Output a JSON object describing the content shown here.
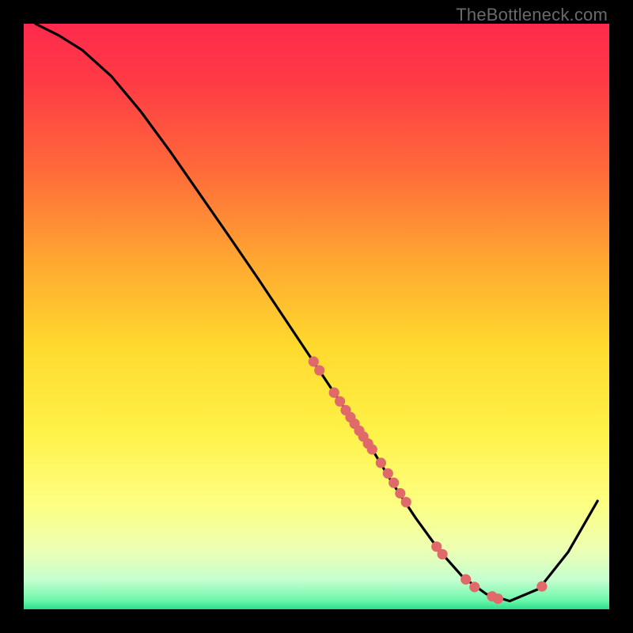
{
  "watermark": "TheBottleneck.com",
  "chart_data": {
    "type": "line",
    "title": "",
    "xlabel": "",
    "ylabel": "",
    "xlim": [
      0,
      100
    ],
    "ylim": [
      0,
      100
    ],
    "gradient_stops": [
      {
        "offset": 0.0,
        "color": "#ff2a4d"
      },
      {
        "offset": 0.1,
        "color": "#ff3b45"
      },
      {
        "offset": 0.25,
        "color": "#ff6a3a"
      },
      {
        "offset": 0.4,
        "color": "#ffa531"
      },
      {
        "offset": 0.55,
        "color": "#ffd92e"
      },
      {
        "offset": 0.7,
        "color": "#fff248"
      },
      {
        "offset": 0.82,
        "color": "#fdff82"
      },
      {
        "offset": 0.9,
        "color": "#ecffb4"
      },
      {
        "offset": 0.95,
        "color": "#c5ffcf"
      },
      {
        "offset": 0.985,
        "color": "#6cf7ab"
      },
      {
        "offset": 1.0,
        "color": "#2bdc8b"
      }
    ],
    "series": [
      {
        "name": "bottleneck-curve",
        "x": [
          2,
          6,
          10,
          15,
          20,
          25,
          30,
          35,
          40,
          45,
          50,
          55,
          60,
          63,
          67,
          71,
          75,
          79,
          83,
          88,
          93,
          98
        ],
        "y": [
          100,
          98,
          95.5,
          91,
          85,
          78.2,
          71,
          63.8,
          56.5,
          49,
          41.5,
          34,
          26.5,
          21.5,
          15.5,
          10,
          5.5,
          2.6,
          1.4,
          3.5,
          9.8,
          18.5
        ]
      }
    ],
    "scatter": {
      "name": "highlight-points",
      "x": [
        49.5,
        50.5,
        53,
        54,
        55,
        55.8,
        56.5,
        57.3,
        58,
        58.8,
        59.5,
        61,
        62.2,
        63.2,
        64.3,
        65.3,
        70.5,
        71.5,
        75.5,
        77,
        80,
        81,
        88.5
      ],
      "y": [
        42.3,
        40.8,
        37,
        35.5,
        34,
        32.8,
        31.7,
        30.5,
        29.5,
        28.3,
        27.3,
        25,
        23.2,
        21.6,
        19.8,
        18.3,
        10.7,
        9.4,
        5.1,
        3.8,
        2.2,
        1.8,
        3.9
      ],
      "color": "#e06a6a",
      "radius": 6.6
    }
  }
}
